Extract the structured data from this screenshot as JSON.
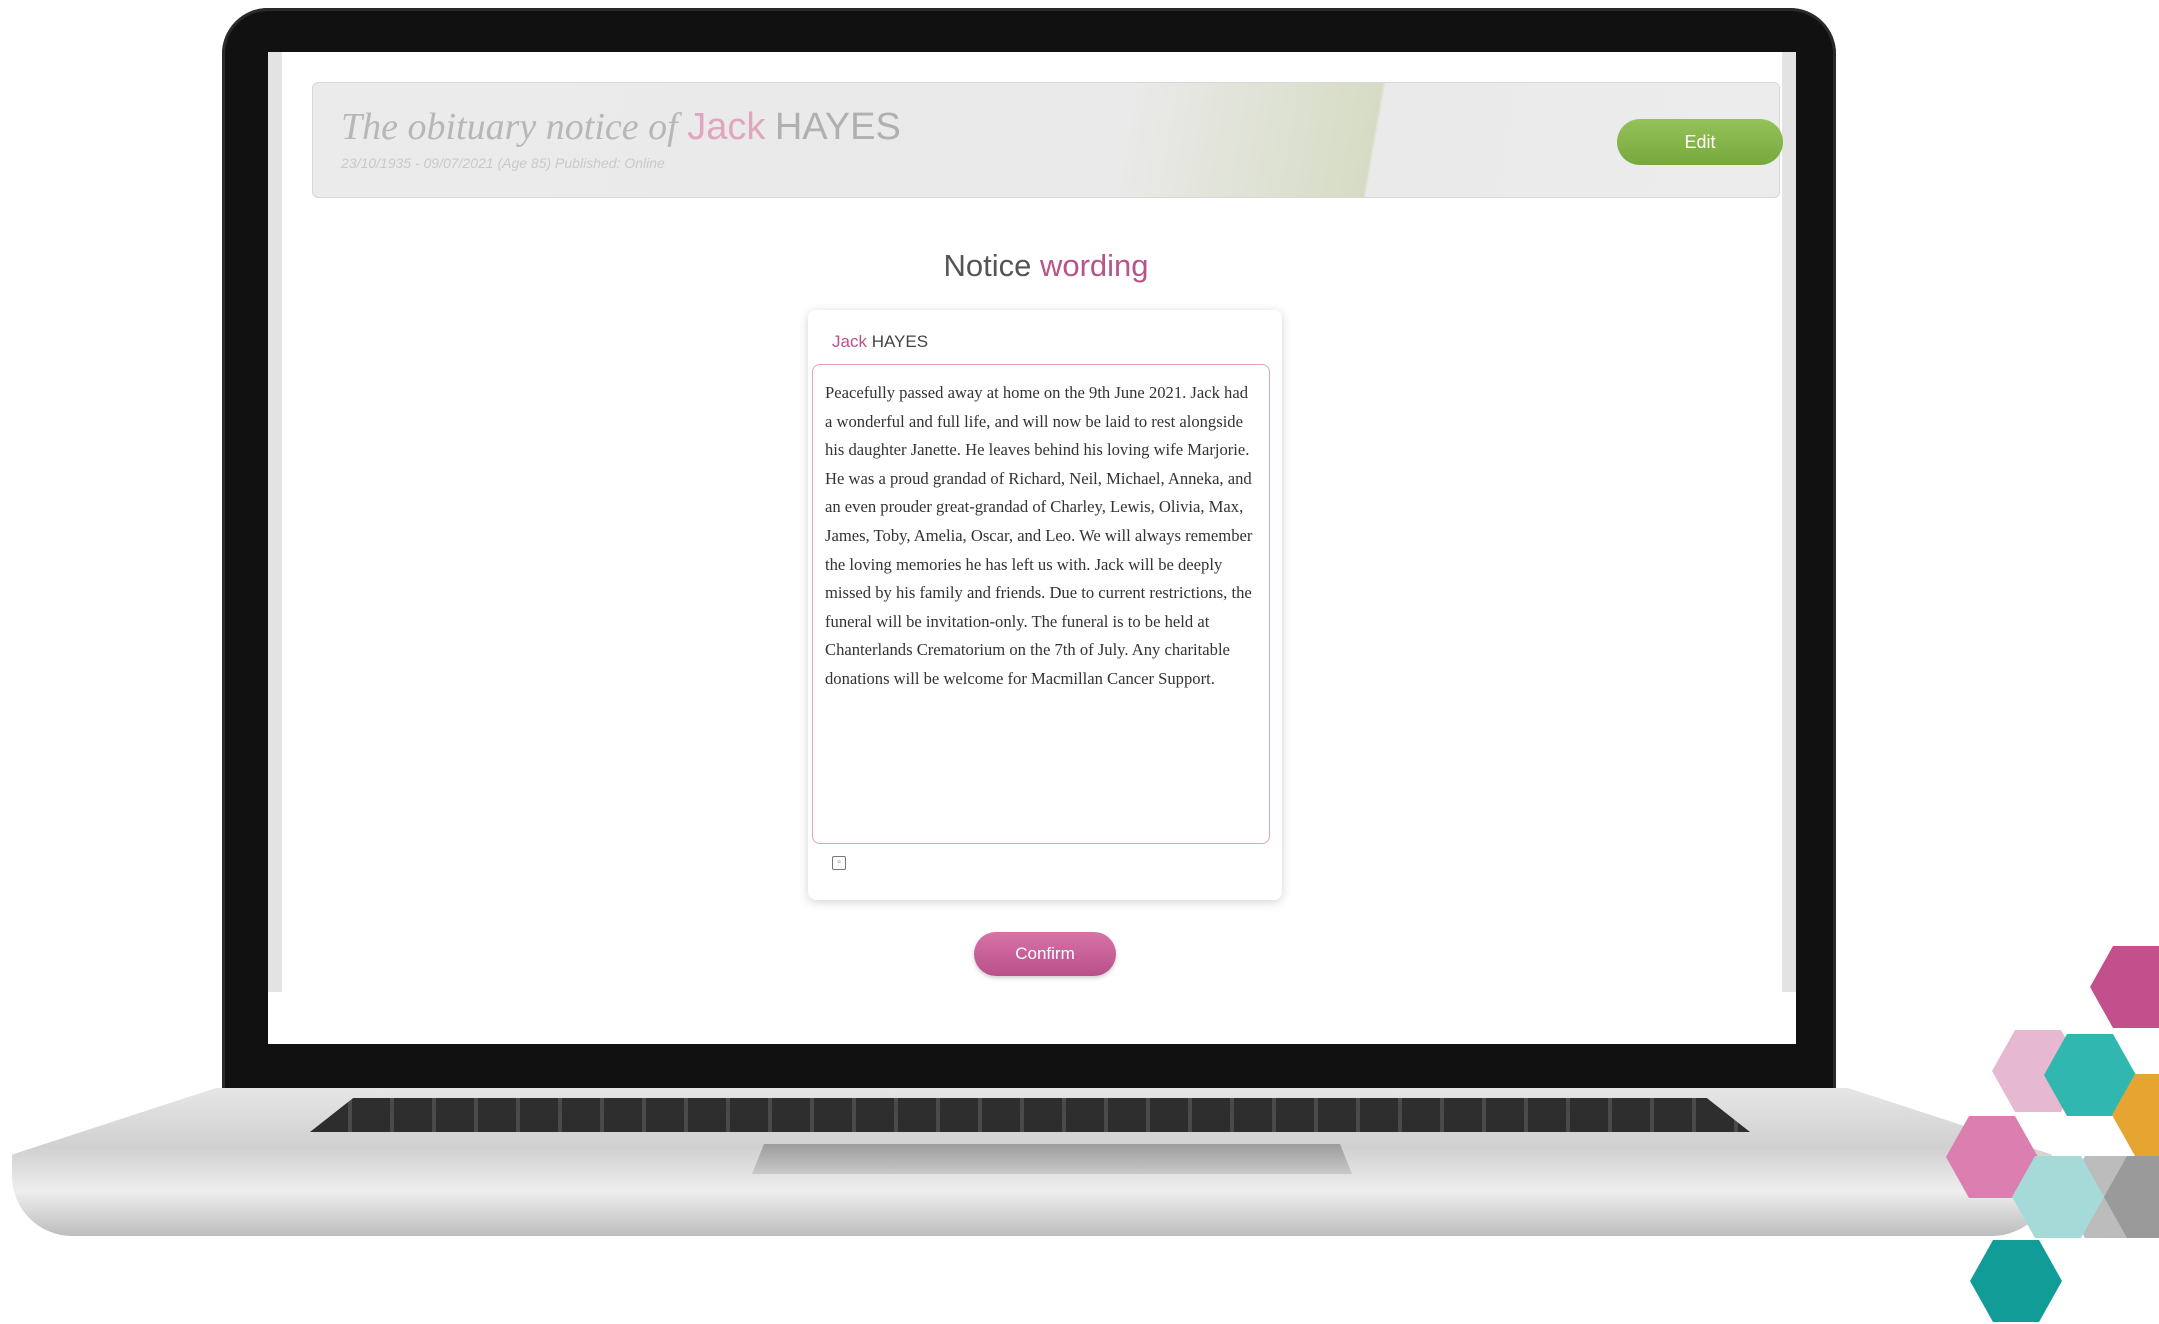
{
  "header": {
    "title_prefix": "The obituary notice of",
    "first_name": "Jack",
    "last_name": "HAYES",
    "subtitle": "23/10/1935 - 09/07/2021 (Age 85) Published: Online",
    "edit_label": "Edit"
  },
  "section": {
    "title_main": "Notice",
    "title_accent": "wording"
  },
  "card": {
    "first_name": "Jack",
    "last_name": "HAYES",
    "notice_text": "Peacefully passed away at home on the 9th June 2021. Jack had a wonderful and full life, and will now be laid to rest alongside his daughter Janette. He leaves behind his loving wife Marjorie. He was a proud grandad of Richard, Neil, Michael, Anneka, and an even prouder great-grandad of Charley, Lewis, Olivia, Max, James, Toby, Amelia, Oscar, and Leo. We will always remember the loving memories he has left us with. Jack will be deeply missed by his family and friends. Due to current restrictions, the funeral will be invitation-only. The funeral is to be held at Chanterlands Crematorium on the 7th of July. Any charitable donations will be welcome for Macmillan Cancer Support.",
    "icon": "document-icon"
  },
  "actions": {
    "confirm_label": "Confirm"
  },
  "colors": {
    "accent": "#b8548a",
    "edit_button": "#86b64b",
    "confirm_button": "#c8609a",
    "hex_colors": [
      "#c2508d",
      "#e6b8d2",
      "#2fb7b0",
      "#e6a431",
      "#da7fb0",
      "#bcbcbc",
      "#a5dad8",
      "#129c98",
      "#9a9a9a"
    ]
  }
}
